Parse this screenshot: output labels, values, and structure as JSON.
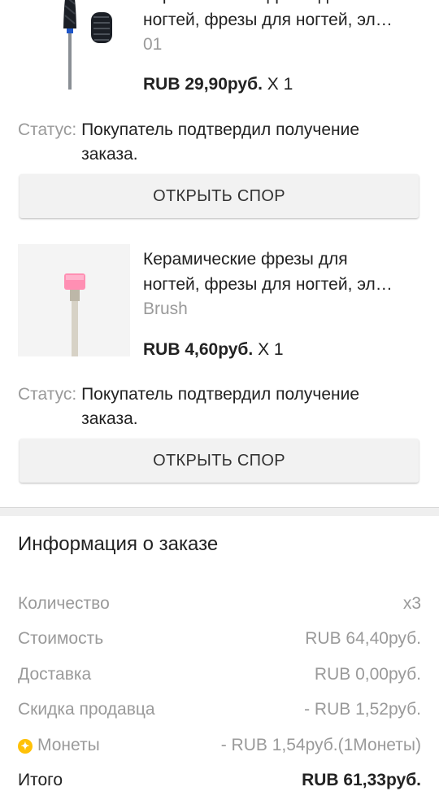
{
  "items": [
    {
      "title_line1": "Керамические фрезы для",
      "title_line2": "ногтей, фрезы для ногтей, эл…",
      "variant": "01",
      "price": "RUB 29,90руб.",
      "qty": "X 1",
      "status_label": "Статус:",
      "status_text": "Покупатель подтвердил получение заказа.",
      "button": "ОТКРЫТЬ СПОР"
    },
    {
      "title_line1": "Керамические фрезы для",
      "title_line2": "ногтей, фрезы для ногтей, эл…",
      "variant": "Brush",
      "price": "RUB 4,60руб.",
      "qty": "X 1",
      "status_label": "Статус:",
      "status_text": "Покупатель подтвердил получение заказа.",
      "button": "ОТКРЫТЬ СПОР"
    }
  ],
  "order_info": {
    "title": "Информация о заказе",
    "rows": [
      {
        "label": "Количество",
        "value": "x3"
      },
      {
        "label": "Стоимость",
        "value": "RUB 64,40руб."
      },
      {
        "label": "Доставка",
        "value": "RUB 0,00руб."
      },
      {
        "label": "Скидка продавца",
        "value": "- RUB 1,52руб."
      },
      {
        "label": "Монеты",
        "value": "- RUB 1,54руб.(1Монеты)",
        "icon": "coin-icon"
      },
      {
        "label": "Итого",
        "value": "RUB 61,33руб."
      }
    ]
  },
  "colors": {
    "coin": "#ffc107",
    "muted": "#9a9a9a",
    "button_bg": "#f2f2f2"
  }
}
